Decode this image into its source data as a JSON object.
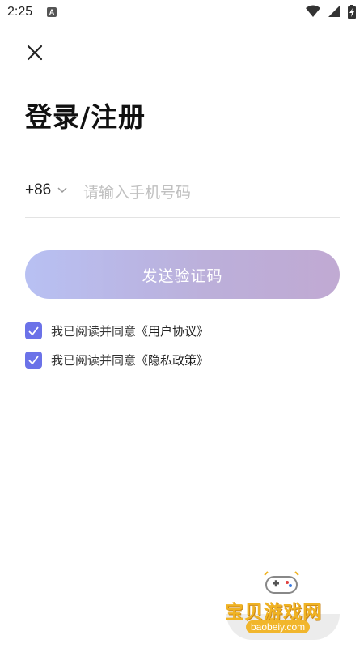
{
  "status_bar": {
    "time": "2:25",
    "notification_icon": "A"
  },
  "header": {
    "close_icon": "close-icon",
    "title": "登录/注册"
  },
  "phone_form": {
    "country_code": "+86",
    "phone_placeholder": "请输入手机号码",
    "phone_value": ""
  },
  "actions": {
    "send_code_label": "发送验证码"
  },
  "agreements": [
    {
      "prefix": "我已阅读并同意",
      "link": "《用户协议》",
      "checked": true
    },
    {
      "prefix": "我已阅读并同意",
      "link": "《隐私政策》",
      "checked": true
    }
  ],
  "watermark": {
    "title": "宝贝游戏网",
    "url": "baobeiy.com"
  },
  "colors": {
    "accent": "#6b72e8",
    "button_gradient_start": "#b4bdf2",
    "button_gradient_end": "#bda5d0",
    "watermark": "#f0b323"
  }
}
